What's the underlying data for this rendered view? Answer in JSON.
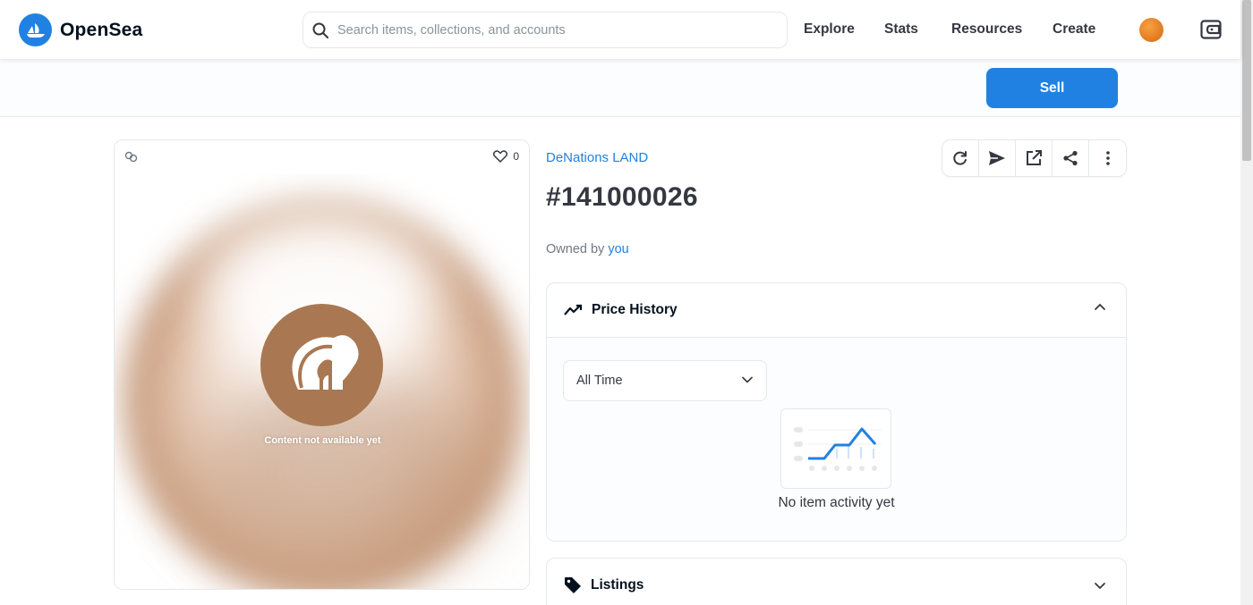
{
  "nav": {
    "brand": "OpenSea",
    "search_placeholder": "Search items, collections, and accounts",
    "links": [
      "Explore",
      "Stats",
      "Resources",
      "Create"
    ]
  },
  "subbar": {
    "sell_label": "Sell"
  },
  "media": {
    "favorites_count": "0",
    "content_note": "Content not available yet"
  },
  "item": {
    "collection": "DeNations LAND",
    "title": "#141000026",
    "owned_prefix": "Owned by",
    "owner": "you"
  },
  "price_history": {
    "title": "Price History",
    "range_value": "All Time",
    "empty_text": "No item activity yet"
  },
  "listings": {
    "title": "Listings"
  },
  "colors": {
    "accent": "#2081e2",
    "text": "#04111d",
    "placeholder_brown": "#a97852"
  }
}
